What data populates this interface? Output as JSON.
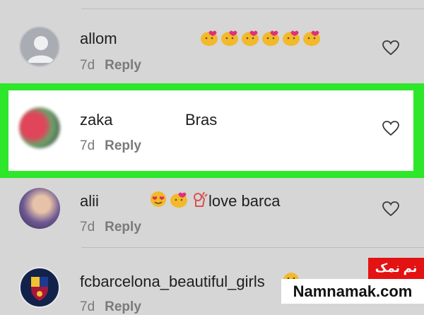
{
  "comments": [
    {
      "username": "allom",
      "text": "",
      "emojis": [
        "kiss-emoji",
        "kiss-emoji",
        "kiss-emoji",
        "kiss-emoji",
        "kiss-emoji",
        "kiss-emoji"
      ],
      "age": "7d",
      "reply_label": "Reply",
      "avatar": "default-avatar"
    },
    {
      "username": "zaka",
      "text": "Bras",
      "emojis": [],
      "age": "7d",
      "reply_label": "Reply",
      "avatar": "blurred-photo-avatar",
      "highlighted": true
    },
    {
      "username": "alii",
      "text": "love barca",
      "emojis": [
        "heart-eyes-emoji",
        "kiss-emoji",
        "ok-hand-emoji"
      ],
      "age": "7d",
      "reply_label": "Reply",
      "avatar": "photo-avatar"
    },
    {
      "username": "fcbarcelona_beautiful_girls",
      "text": "",
      "emojis": [
        "smile-emoji"
      ],
      "age": "7d",
      "reply_label": "Reply",
      "avatar": "fcb-logo-avatar"
    }
  ],
  "colors": {
    "highlight": "#2ee62a",
    "badge": "#e31313"
  },
  "watermark": {
    "badge_text": "نم نمک",
    "site": "Namnamak.com"
  }
}
